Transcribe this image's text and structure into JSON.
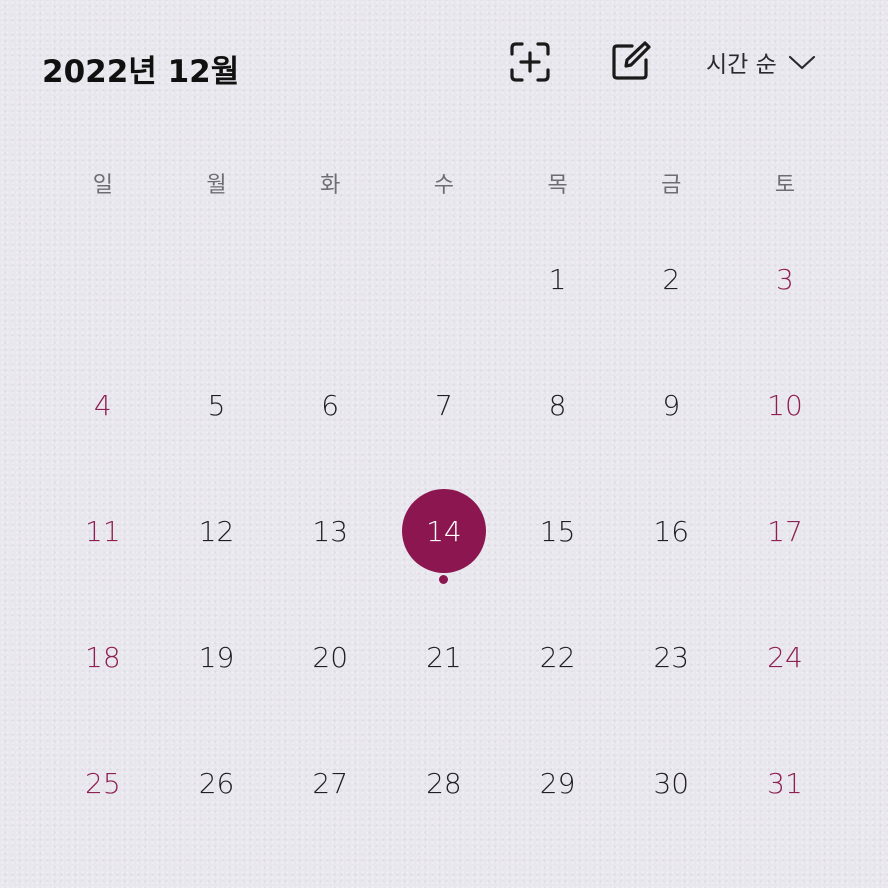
{
  "header": {
    "title": "2022년 12월",
    "scan_icon": "add-scan-icon",
    "edit_icon": "edit-note-icon",
    "sort_label": "시간 순",
    "sort_icon": "chevron-down-icon"
  },
  "weekdays": [
    "일",
    "월",
    "화",
    "수",
    "목",
    "금",
    "토"
  ],
  "weeks": [
    [
      "",
      "",
      "",
      "",
      "1",
      "2",
      "3"
    ],
    [
      "4",
      "5",
      "6",
      "7",
      "8",
      "9",
      "10"
    ],
    [
      "11",
      "12",
      "13",
      "14",
      "15",
      "16",
      "17"
    ],
    [
      "18",
      "19",
      "20",
      "21",
      "22",
      "23",
      "24"
    ],
    [
      "25",
      "26",
      "27",
      "28",
      "29",
      "30",
      "31"
    ]
  ],
  "selected_day": "14",
  "event_days": [
    "14"
  ],
  "colors": {
    "accent": "#8b1650",
    "weekend": "#8e1f52",
    "text": "#1f1e24",
    "weekday_header": "#6f6d74",
    "background": "#e9e7ee"
  }
}
